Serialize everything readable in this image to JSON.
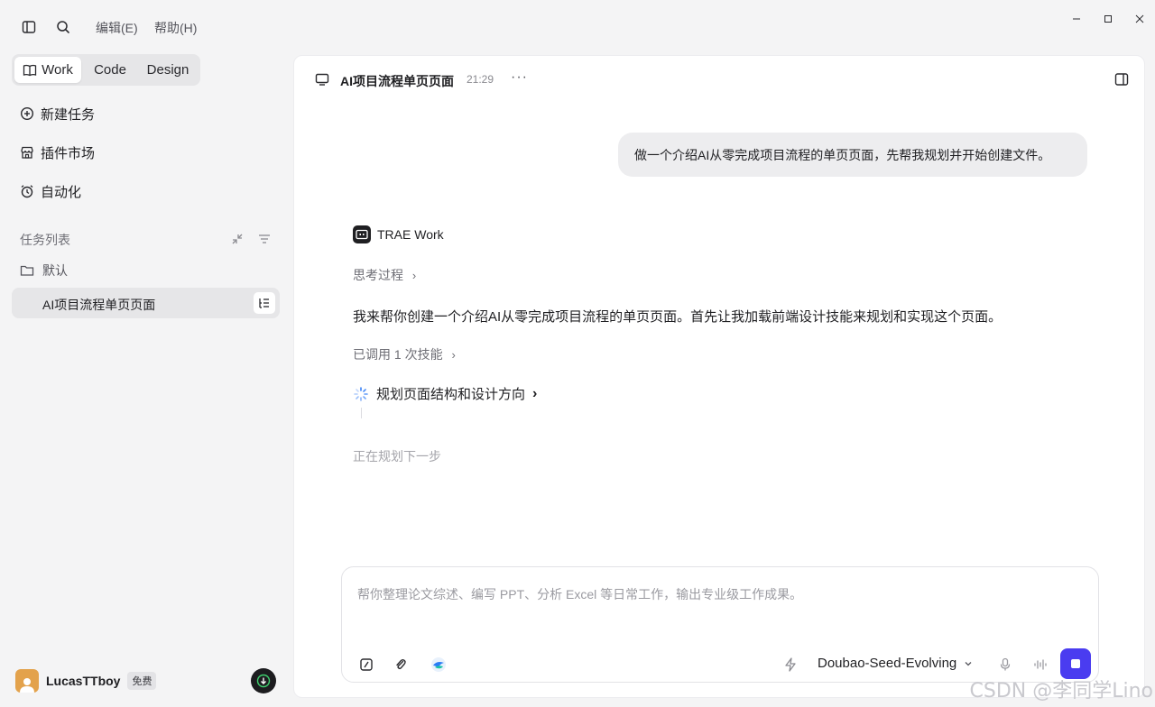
{
  "menu": {
    "edit": "编辑(E)",
    "help": "帮助(H)"
  },
  "modes": [
    "Work",
    "Code",
    "Design"
  ],
  "nav": {
    "new_task": "新建任务",
    "plugins": "插件市场",
    "automation": "自动化"
  },
  "task_list": {
    "label": "任务列表",
    "folder": "默认",
    "active_task": "AI项目流程单页页面"
  },
  "user": {
    "name": "LucasTTboy",
    "plan": "免费"
  },
  "conversation": {
    "title": "AI项目流程单页页面",
    "time": "21:29",
    "more": "···",
    "user_message": "做一个介绍AI从零完成项目流程的单页页面，先帮我规划并开始创建文件。",
    "agent_name": "TRAE Work",
    "thinking_label": "思考过程",
    "response": "我来帮你创建一个介绍AI从零完成项目流程的单页页面。首先让我加载前端设计技能来规划和实现这个页面。",
    "skill_call": "已调用 1 次技能",
    "step": "规划页面结构和设计方向",
    "status": "正在规划下一步"
  },
  "input": {
    "placeholder": "帮你整理论文综述、编写 PPT、分析 Excel 等日常工作，输出专业级工作成果。",
    "model": "Doubao-Seed-Evolving"
  },
  "colors": {
    "accent": "#4a3cf0",
    "sidebar_bg": "#f4f4f5",
    "active_bg": "#e6e6e8"
  },
  "watermark": "CSDN @李同学Lino"
}
